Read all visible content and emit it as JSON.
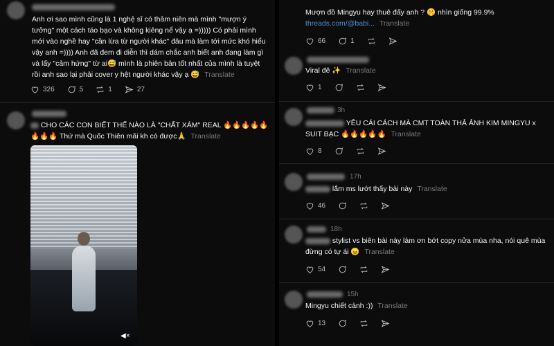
{
  "left": {
    "post1": {
      "text": "Anh ơi sao mình cũng là 1 nghệ sĩ có thâm niên mà mình \"mượn ý tưởng\" một cách táo bạo và không kiêng nể vậy ạ =))))) Có phải mình mới vào nghề hay \"cần lừa từ người khác\" đâu mà làm tới mức khó hiểu vậy anh =)))) Anh đã đem đi diễn thì dám chắc anh biết anh đang làm gì và lấy \"cảm hứng\" từ ai😅 mình là phiên bản tốt nhất của mình là tuyệt rồi anh sao lại phải cover y hệt người khác vậy ạ 😅",
      "translate": "Translate",
      "likes": "326",
      "replies": "5",
      "reposts": "1",
      "shares": "27"
    },
    "post2": {
      "text": "CHO CÁC CON BIẾT THẾ NÀO LÀ \"CHẤT XÁM\" REAL 🔥🔥🔥🔥🔥🔥🔥🔥 Thứ mà Quốc Thiên mãi kh có được🙏",
      "translate": "Translate"
    }
  },
  "right": {
    "c1": {
      "text": "Mượn đồ Mingyu hay thuê đấy anh ? 🤫 nhìn giống 99.9%",
      "link": "threads.com/@babi...",
      "translate": "Translate",
      "likes": "66",
      "replies": "1"
    },
    "c2": {
      "text": "Viral đê ✨",
      "translate": "Translate",
      "likes": "1"
    },
    "c3": {
      "time": "3h",
      "text": "YÊU CÁI CÁCH MÀ CMT TOÀN THẢ ẢNH KIM MINGYU x SUIT BẠC 🔥🔥🔥🔥🔥",
      "translate": "Translate",
      "likes": "8"
    },
    "c4": {
      "time": "17h",
      "text": "lắm ms lướt thấy bài này",
      "translate": "Translate",
      "likes": "46"
    },
    "c5": {
      "time": "18h",
      "text": "stylist vs biên bài này làm ơn bớt copy nửa mùa nha, nói quê mùa đừng có tự ái 😠",
      "translate": "Translate",
      "likes": "54"
    },
    "c6": {
      "time": "15h",
      "text": "Mingyu chiết cành :))",
      "translate": "Translate",
      "likes": "13"
    }
  },
  "icons": [
    "heart-icon",
    "comment-icon",
    "repost-icon",
    "share-icon"
  ]
}
